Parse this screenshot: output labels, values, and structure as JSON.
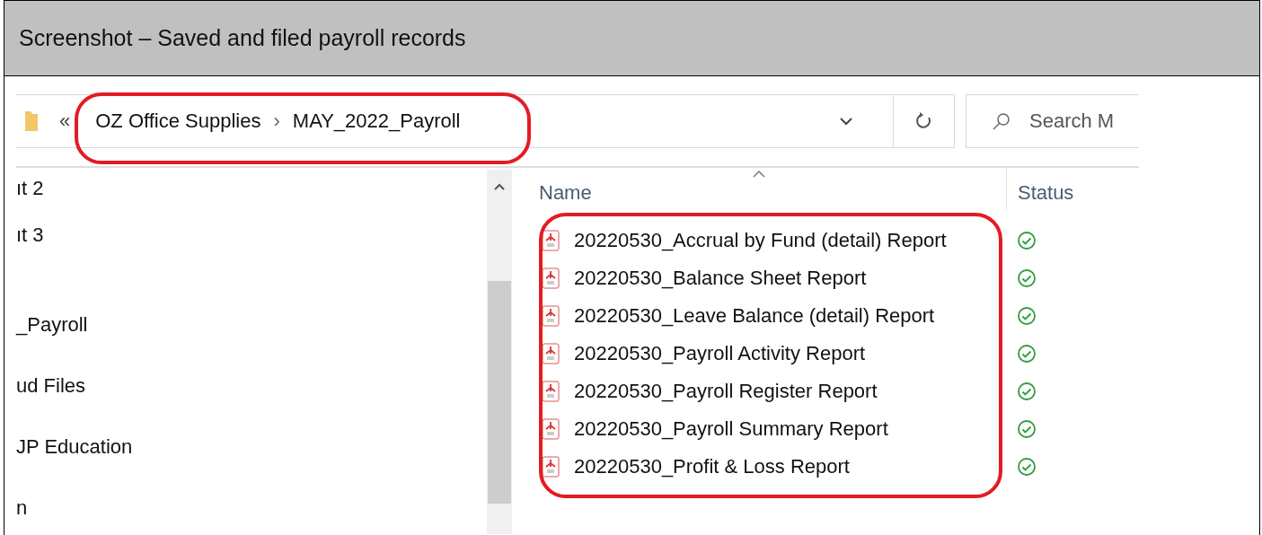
{
  "caption": {
    "title": "Screenshot – Saved and filed payroll records"
  },
  "address_bar": {
    "overflow": "«",
    "breadcrumbs": [
      "OZ Office Supplies",
      "MAY_2022_Payroll"
    ],
    "separator": "›"
  },
  "search": {
    "placeholder": "Search M"
  },
  "nav_pane": {
    "items": [
      {
        "label": "ıt 2"
      },
      {
        "label": "ıt 3"
      },
      {
        "label": "_Payroll"
      },
      {
        "label": "ud Files"
      },
      {
        "label": "JP Education"
      },
      {
        "label": "n"
      }
    ]
  },
  "file_list": {
    "columns": [
      "Name",
      "Status"
    ],
    "rows": [
      {
        "name": "20220530_Accrual by Fund (detail) Report"
      },
      {
        "name": "20220530_Balance Sheet Report"
      },
      {
        "name": "20220530_Leave Balance (detail) Report"
      },
      {
        "name": "20220530_Payroll Activity Report"
      },
      {
        "name": "20220530_Payroll Register Report"
      },
      {
        "name": "20220530_Payroll Summary Report"
      },
      {
        "name": "20220530_Profit & Loss Report"
      }
    ]
  }
}
